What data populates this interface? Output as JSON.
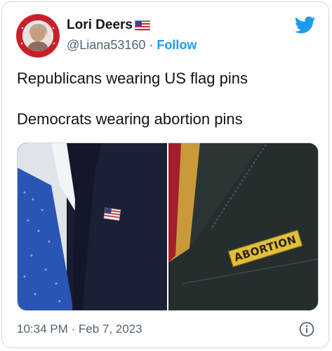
{
  "author": {
    "display_name": "Lori Deers",
    "flag_emoji": "us-flag-emoji",
    "handle": "@Liana53160",
    "separator": "·",
    "follow_label": "Follow"
  },
  "tweet": {
    "line1": "Republicans wearing US flag pins",
    "line2": "Democrats wearing abortion pins"
  },
  "media": {
    "pin_text": "ABORTION"
  },
  "footer": {
    "timestamp": "10:34 PM · Feb 7, 2023",
    "info_icon": "info-icon"
  },
  "colors": {
    "accent": "#1d9bf0",
    "text": "#0f1419",
    "muted": "#536471",
    "border": "#cfd9de"
  }
}
